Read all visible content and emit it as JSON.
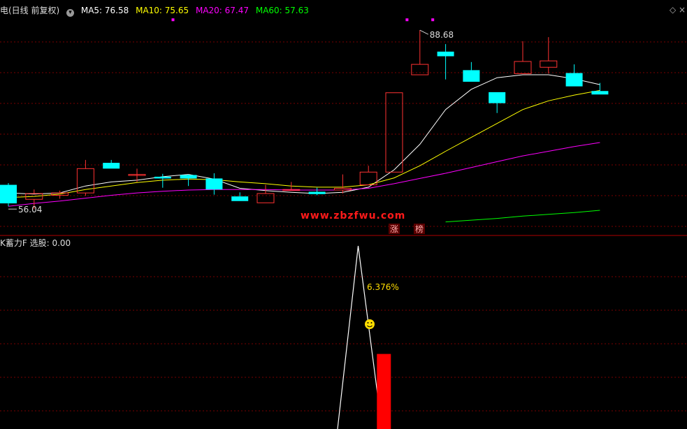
{
  "header": {
    "title": "电(日线 前复权)",
    "ma5_label": "MA5: 76.58",
    "ma10_label": "MA10: 75.65",
    "ma20_label": "MA20: 67.47",
    "ma60_label": "MA60: 57.63",
    "colors": {
      "title": "#dddddd",
      "ma5": "#ffffff",
      "ma10": "#ffff00",
      "ma20": "#ff00ff",
      "ma60": "#00ff00"
    }
  },
  "sub_header": {
    "label": "K蓄力F 选股: 0.00"
  },
  "annotations": {
    "high_label": "88.68",
    "low_label": "56.04",
    "watermark": "www.zbzfwu.com",
    "tag_zhang": "涨",
    "tag_bang": "榜",
    "percent_label": "6.376%"
  },
  "chart_data": [
    {
      "type": "candlestick",
      "title": "",
      "candles": [
        {
          "o": 62.0,
          "h": 62.3,
          "l": 58.3,
          "c": 58.8
        },
        {
          "o": 59.5,
          "h": 61.2,
          "l": 57.8,
          "c": 60.5
        },
        {
          "o": 60.2,
          "h": 61.0,
          "l": 59.6,
          "c": 60.6
        },
        {
          "o": 60.6,
          "h": 66.3,
          "l": 60.1,
          "c": 64.8
        },
        {
          "o": 65.8,
          "h": 66.3,
          "l": 64.8,
          "c": 64.8
        },
        {
          "o": 63.8,
          "h": 64.8,
          "l": 62.5,
          "c": 63.8
        },
        {
          "o": 63.4,
          "h": 63.9,
          "l": 61.5,
          "c": 63.1
        },
        {
          "o": 63.7,
          "h": 63.8,
          "l": 61.8,
          "c": 63.1
        },
        {
          "o": 63.1,
          "h": 64.0,
          "l": 60.3,
          "c": 61.2
        },
        {
          "o": 60.0,
          "h": 60.7,
          "l": 59.2,
          "c": 59.2
        },
        {
          "o": 58.9,
          "h": 62.0,
          "l": 58.9,
          "c": 60.5
        },
        {
          "o": 61.1,
          "h": 62.5,
          "l": 61.0,
          "c": 61.2
        },
        {
          "o": 60.8,
          "h": 61.5,
          "l": 60.2,
          "c": 60.4
        },
        {
          "o": 61.1,
          "h": 63.8,
          "l": 60.5,
          "c": 61.4
        },
        {
          "o": 62.0,
          "h": 65.3,
          "l": 61.9,
          "c": 64.2
        },
        {
          "o": 64.2,
          "h": 77.9,
          "l": 64.2,
          "c": 77.9
        },
        {
          "o": 81.0,
          "h": 88.7,
          "l": 81.0,
          "c": 82.8
        },
        {
          "o": 85.0,
          "h": 86.3,
          "l": 80.2,
          "c": 84.2
        },
        {
          "o": 81.8,
          "h": 83.2,
          "l": 79.8,
          "c": 79.8
        },
        {
          "o": 78.0,
          "h": 78.0,
          "l": 74.4,
          "c": 76.1
        },
        {
          "o": 81.2,
          "h": 86.8,
          "l": 81.2,
          "c": 83.3
        },
        {
          "o": 82.3,
          "h": 87.5,
          "l": 81.2,
          "c": 83.4
        },
        {
          "o": 81.3,
          "h": 82.8,
          "l": 79.0,
          "c": 79.0
        },
        {
          "o": 78.2,
          "h": 79.6,
          "l": 77.6,
          "c": 77.6
        }
      ],
      "x_range": [
        0,
        24
      ],
      "ylim": [
        53.5,
        91.5
      ],
      "series": [
        {
          "name": "MA5",
          "color": "#ffffff",
          "values": [
            60.6,
            60.4,
            60.6,
            61.8,
            62.5,
            62.8,
            63.4,
            63.8,
            63.0,
            61.4,
            61.0,
            60.7,
            60.5,
            60.7,
            61.6,
            64.6,
            69.0,
            75.0,
            78.5,
            80.5,
            81.0,
            81.0,
            80.3,
            79.3
          ]
        },
        {
          "name": "MA10",
          "color": "#ffff00",
          "values": [
            59.8,
            60.0,
            60.4,
            61.2,
            61.8,
            62.4,
            62.8,
            63.0,
            62.9,
            62.5,
            62.2,
            61.8,
            61.6,
            61.6,
            62.0,
            63.2,
            65.3,
            67.8,
            70.2,
            72.6,
            75.0,
            76.5,
            77.5,
            78.3
          ]
        },
        {
          "name": "MA20",
          "color": "#ff00ff",
          "values": [
            58.3,
            58.8,
            59.2,
            59.7,
            60.2,
            60.6,
            60.9,
            61.1,
            61.2,
            61.2,
            61.2,
            61.1,
            61.1,
            61.1,
            61.4,
            62.2,
            63.1,
            64.0,
            65.0,
            66.0,
            67.0,
            67.8,
            68.6,
            69.3
          ]
        },
        {
          "name": "MA60",
          "color": "#00ff00",
          "values": [
            null,
            null,
            null,
            null,
            null,
            null,
            null,
            null,
            null,
            null,
            null,
            null,
            null,
            null,
            null,
            null,
            null,
            55.6,
            55.9,
            56.2,
            56.6,
            56.9,
            57.2,
            57.6
          ]
        }
      ]
    },
    {
      "type": "indicator",
      "title": "K蓄力F",
      "line": {
        "color": "#ffffff",
        "points": [
          [
            12.8,
            0
          ],
          [
            13.6,
            1.0
          ],
          [
            14.4,
            0.14
          ]
        ]
      },
      "bar": {
        "color": "#ff0000",
        "x": 14.6,
        "value": 0.41
      },
      "ylim": [
        0,
        1.0
      ]
    }
  ],
  "markers": {
    "dots": [
      [
        6.4,
        90.5
      ],
      [
        15.5,
        90.5
      ],
      [
        16.5,
        90.5
      ]
    ]
  }
}
